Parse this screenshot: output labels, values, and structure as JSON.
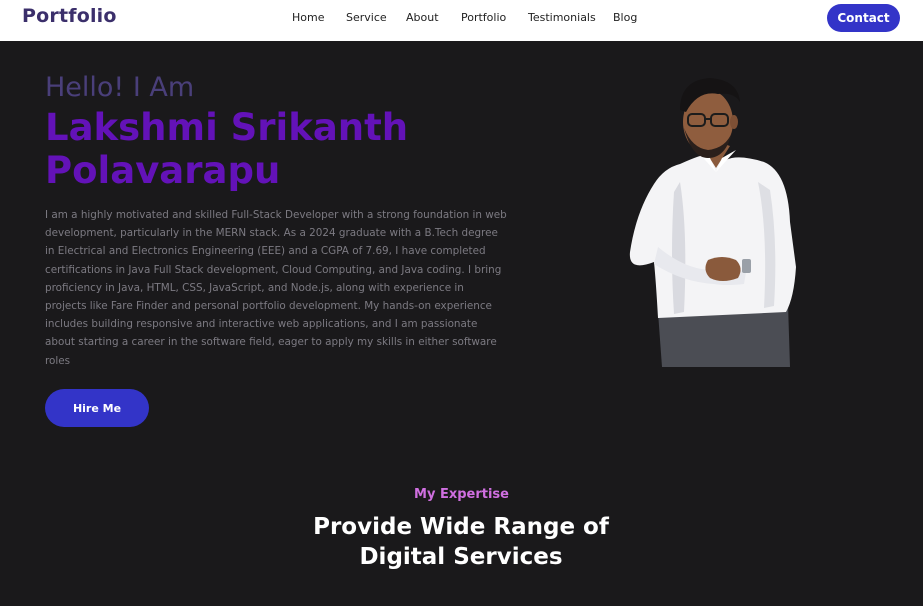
{
  "header": {
    "brand": "Portfolio",
    "nav": [
      {
        "label": "Home"
      },
      {
        "label": "Service"
      },
      {
        "label": "About"
      },
      {
        "label": "Portfolio"
      },
      {
        "label": "Testimonials"
      },
      {
        "label": "Blog"
      }
    ],
    "contact_label": "Contact"
  },
  "hero": {
    "greeting": "Hello! I Am",
    "name": "Lakshmi Srikanth Polavarapu",
    "bio": "I am a highly motivated and skilled Full-Stack Developer with a strong foundation in web development, particularly in the MERN stack. As a 2024 graduate with a B.Tech degree in Electrical and Electronics Engineering (EEE) and a CGPA of 7.69, I have completed certifications in Java Full Stack development, Cloud Computing, and Java coding. I bring proficiency in Java, HTML, CSS, JavaScript, and Node.js, along with experience in projects like Fare Finder and personal portfolio development. My hands-on experience includes building responsive and interactive web applications, and I am passionate about starting a career in the software field, eager to apply my skills in either software roles",
    "hire_label": "Hire Me"
  },
  "expertise": {
    "eyebrow": "My Expertise",
    "title": "Provide Wide Range of Digital Services"
  },
  "colors": {
    "accent_button": "#3334c8",
    "name_purple": "#6312b8",
    "eyebrow_pink": "#cf6fe0",
    "background": "#1a191b"
  }
}
